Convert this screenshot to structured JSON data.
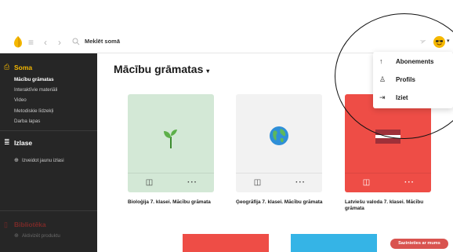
{
  "topbar": {
    "search_label": "Meklēt somā",
    "icons": [
      "hamburger-icon",
      "back-icon",
      "forward-icon",
      "search-icon",
      "send-icon",
      "avatar"
    ]
  },
  "sidebar": {
    "soma_label": "Soma",
    "soma_items": [
      {
        "label": "Mācību grāmatas",
        "current": true
      },
      {
        "label": "Interaktīvie materiāli"
      },
      {
        "label": "Video"
      },
      {
        "label": "Metodiskie līdzekļi"
      },
      {
        "label": "Darba lapas"
      }
    ],
    "izlase_label": "Izlase",
    "izlase_create": "Izveidot jaunu izlasi",
    "biblioteka_label": "Bibliotēka",
    "activate_label": "Aktivizēt produktu"
  },
  "main": {
    "title": "Mācību grāmatas",
    "books": [
      {
        "title": "Bioloģija 7. klasei. Mācību grāmata",
        "cover_color": "#d3e8d6",
        "icon": "sprout-icon"
      },
      {
        "title": "Ģeogrāfija 7. klasei. Mācību grāmata",
        "cover_color": "#f2f2f2",
        "icon": "globe-icon"
      },
      {
        "title": "Latviešu valoda 7. klasei. Mācību grāmata",
        "cover_color": "#ee4d46",
        "icon": "latvian-flag-icon"
      }
    ],
    "bottom_colors": [
      "#ee4d46",
      "#35b4e6"
    ]
  },
  "menu": {
    "items": [
      {
        "label": "Abonements",
        "icon": "arrow-up-icon"
      },
      {
        "label": "Profils",
        "icon": "user-icon"
      },
      {
        "label": "Iziet",
        "icon": "logout-icon"
      }
    ]
  },
  "contact_label": "Sazinieties ar mums",
  "colors": {
    "accent": "#f5b800",
    "sidebar": "#262626",
    "brand_red": "#d9534f"
  }
}
